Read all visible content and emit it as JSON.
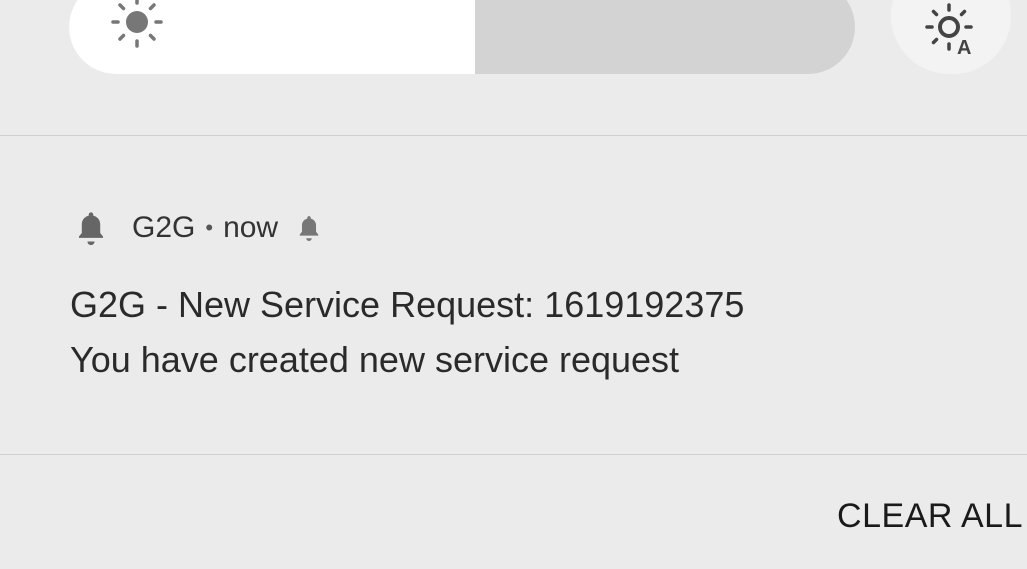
{
  "brightness": {
    "level_fraction": 0.517,
    "icon": "brightness-icon"
  },
  "auto_brightness": {
    "icon": "auto-brightness-icon"
  },
  "notification": {
    "app_icon": "bell-icon",
    "app_name": "G2G",
    "separator": "•",
    "time": "now",
    "alert_icon": "bell-icon",
    "title": "G2G - New Service Request: 1619192375",
    "text": "You have created new service request"
  },
  "footer": {
    "clear_all_label": "CLEAR ALL"
  },
  "colors": {
    "background": "#ebebeb",
    "slider_fill": "#ffffff",
    "slider_track": "#d3d3d3"
  }
}
